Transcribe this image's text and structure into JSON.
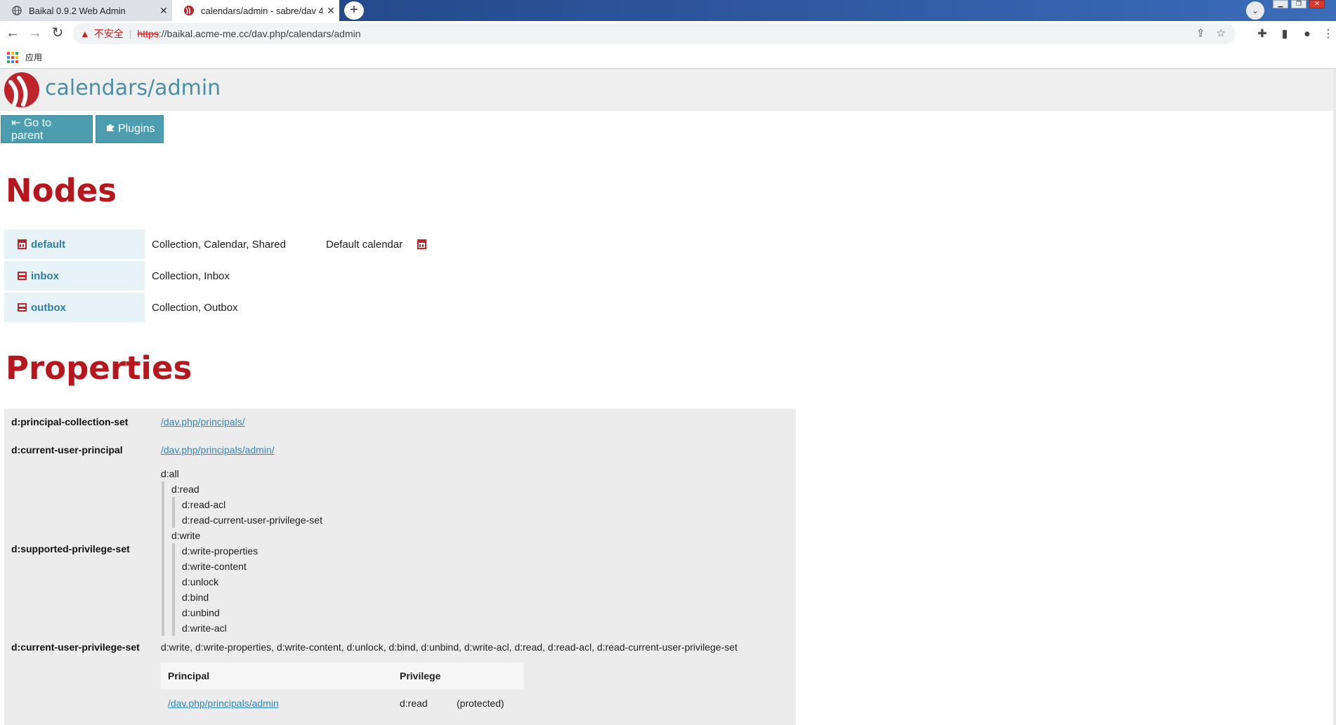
{
  "browser": {
    "tabs": [
      {
        "title": "Baikal 0.9.2 Web Admin",
        "active": false
      },
      {
        "title": "calendars/admin - sabre/dav 4",
        "active": true
      }
    ],
    "new_tab": "+",
    "tab_search": "⌄",
    "security_label": "不安全",
    "url_scheme": "https",
    "url_rest": "://baikal.acme-me.cc/dav.php/calendars/admin",
    "bookmarks_apps_label": "应用"
  },
  "page": {
    "title": "calendars/admin",
    "buttons": {
      "go_to_parent": "⇤ Go to parent",
      "plugins": "Plugins"
    },
    "nodes_heading": "Nodes",
    "nodes": [
      {
        "name": "default",
        "type": "Collection, Calendar, Shared",
        "description": "Default calendar",
        "icon": "calendar-icon"
      },
      {
        "name": "inbox",
        "type": "Collection, Inbox",
        "description": "",
        "icon": "inbox-icon"
      },
      {
        "name": "outbox",
        "type": "Collection, Outbox",
        "description": "",
        "icon": "outbox-icon"
      }
    ],
    "properties_heading": "Properties",
    "properties": {
      "principal_collection_set": {
        "key": "d:principal-collection-set",
        "value": "/dav.php/principals/"
      },
      "current_user_principal": {
        "key": "d:current-user-principal",
        "value": "/dav.php/principals/admin/"
      },
      "supported_privilege_set": {
        "key": "d:supported-privilege-set",
        "root": "d:all",
        "read": "d:read",
        "read_children": [
          "d:read-acl",
          "d:read-current-user-privilege-set"
        ],
        "write": "d:write",
        "write_children": [
          "d:write-properties",
          "d:write-content",
          "d:unlock",
          "d:bind",
          "d:unbind",
          "d:write-acl"
        ]
      },
      "current_user_privilege_set": {
        "key": "d:current-user-privilege-set",
        "value": "d:write, d:write-properties, d:write-content, d:unlock, d:bind, d:unbind, d:write-acl, d:read, d:read-acl, d:read-current-user-privilege-set"
      },
      "acl": {
        "headers": {
          "principal": "Principal",
          "privilege": "Privilege"
        },
        "rows": [
          {
            "principal": "/dav.php/principals/admin",
            "privilege": "d:read",
            "note": "(protected)"
          }
        ]
      }
    }
  },
  "colors": {
    "accent_red": "#b7161d",
    "button_teal": "#4d9db0",
    "link_blue": "#2f86b8",
    "title_teal": "#4a8fa3"
  }
}
